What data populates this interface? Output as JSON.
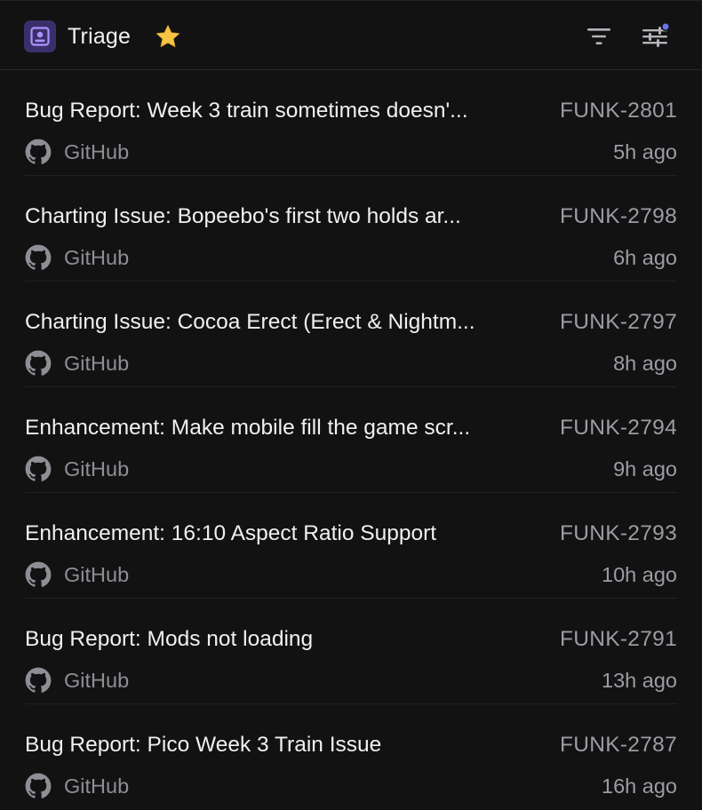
{
  "header": {
    "title": "Triage",
    "icons": {
      "team": "team-icon",
      "favorite": "star-icon",
      "filter": "filter-icon",
      "display": "display-options-icon"
    },
    "colors": {
      "team_icon_bg": "#3b2f6b",
      "team_icon_fg": "#a995ff",
      "star": "#f6c544",
      "notification_dot": "#6c74e8"
    }
  },
  "issues": [
    {
      "title": "Bug Report: Week 3 train sometimes doesn'...",
      "id": "FUNK-2801",
      "source": "GitHub",
      "time": "5h ago"
    },
    {
      "title": "Charting Issue: Bopeebo's first two holds ar...",
      "id": "FUNK-2798",
      "source": "GitHub",
      "time": "6h ago"
    },
    {
      "title": "Charting Issue: Cocoa Erect (Erect & Nightm...",
      "id": "FUNK-2797",
      "source": "GitHub",
      "time": "8h ago"
    },
    {
      "title": "Enhancement: Make mobile fill the game scr...",
      "id": "FUNK-2794",
      "source": "GitHub",
      "time": "9h ago"
    },
    {
      "title": "Enhancement: 16:10 Aspect Ratio Support",
      "id": "FUNK-2793",
      "source": "GitHub",
      "time": "10h ago"
    },
    {
      "title": "Bug Report: Mods not loading",
      "id": "FUNK-2791",
      "source": "GitHub",
      "time": "13h ago"
    },
    {
      "title": "Bug Report: Pico Week 3 Train Issue",
      "id": "FUNK-2787",
      "source": "GitHub",
      "time": "16h ago"
    }
  ]
}
